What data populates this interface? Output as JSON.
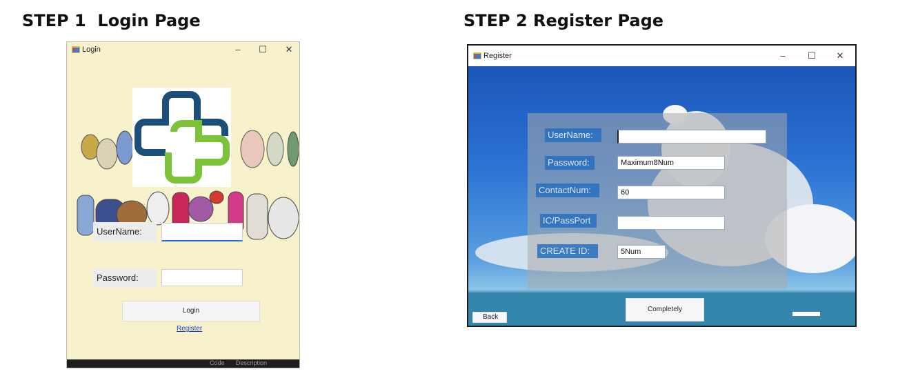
{
  "headings": {
    "step1": "STEP 1  Login Page",
    "step2": "STEP 2 Register Page"
  },
  "login_window": {
    "title": "Login",
    "controls": {
      "minimize": "–",
      "maximize": "☐",
      "close": "✕"
    },
    "username_label": "UserName:",
    "password_label": "Password:",
    "username_value": "",
    "password_value": "",
    "login_button": "Login",
    "register_link": "Register",
    "bottom_bar": {
      "code": "Code",
      "description": "Description"
    }
  },
  "register_window": {
    "title": "Register",
    "controls": {
      "minimize": "–",
      "maximize": "☐",
      "close": "✕"
    },
    "fields": [
      {
        "label": "UserName:",
        "value": ""
      },
      {
        "label": "Password:",
        "value": "Maximum8Num"
      },
      {
        "label": "ContactNum:",
        "value": "60"
      },
      {
        "label": "IC/PassPort",
        "value": ""
      },
      {
        "label": "CREATE ID:",
        "value": "5Num"
      }
    ],
    "complete_button": "Completely",
    "back_button": "Back"
  },
  "colors": {
    "login_bg": "#f8f2cc",
    "logo_blue": "#1c4e7a",
    "logo_green": "#7cc33a",
    "link_blue": "#1a3cc9",
    "sky_blue": "#2d74d4"
  },
  "icons": {
    "window_icon": "app-window-icon",
    "logo": "medical-cross-logo"
  }
}
